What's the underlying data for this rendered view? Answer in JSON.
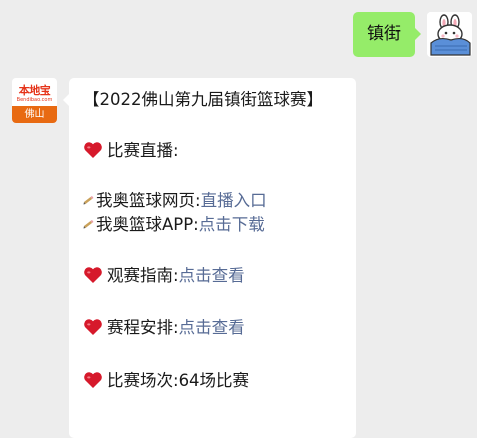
{
  "outgoing": {
    "text": "镇街"
  },
  "bot": {
    "logo_text": "本地宝",
    "logo_sub": "Bendibao.com",
    "city": "佛山"
  },
  "message": {
    "title": "【2022佛山第九届镇街篮球赛】",
    "live_label": "比赛直播:",
    "web_label": "我奥篮球网页:",
    "web_link": "直播入口",
    "app_label": "我奥篮球APP:",
    "app_link": "点击下载",
    "guide_label": "观赛指南:",
    "guide_link": "点击查看",
    "schedule_label": "赛程安排:",
    "schedule_link": "点击查看",
    "count_label": "比赛场次:",
    "count_value": "64场比赛"
  },
  "colors": {
    "outgoing_bubble": "#95ec69",
    "link": "#576b95",
    "heart": "#d6192b",
    "background": "#ededed"
  },
  "icons": [
    "heart-icon",
    "pencil-icon"
  ]
}
